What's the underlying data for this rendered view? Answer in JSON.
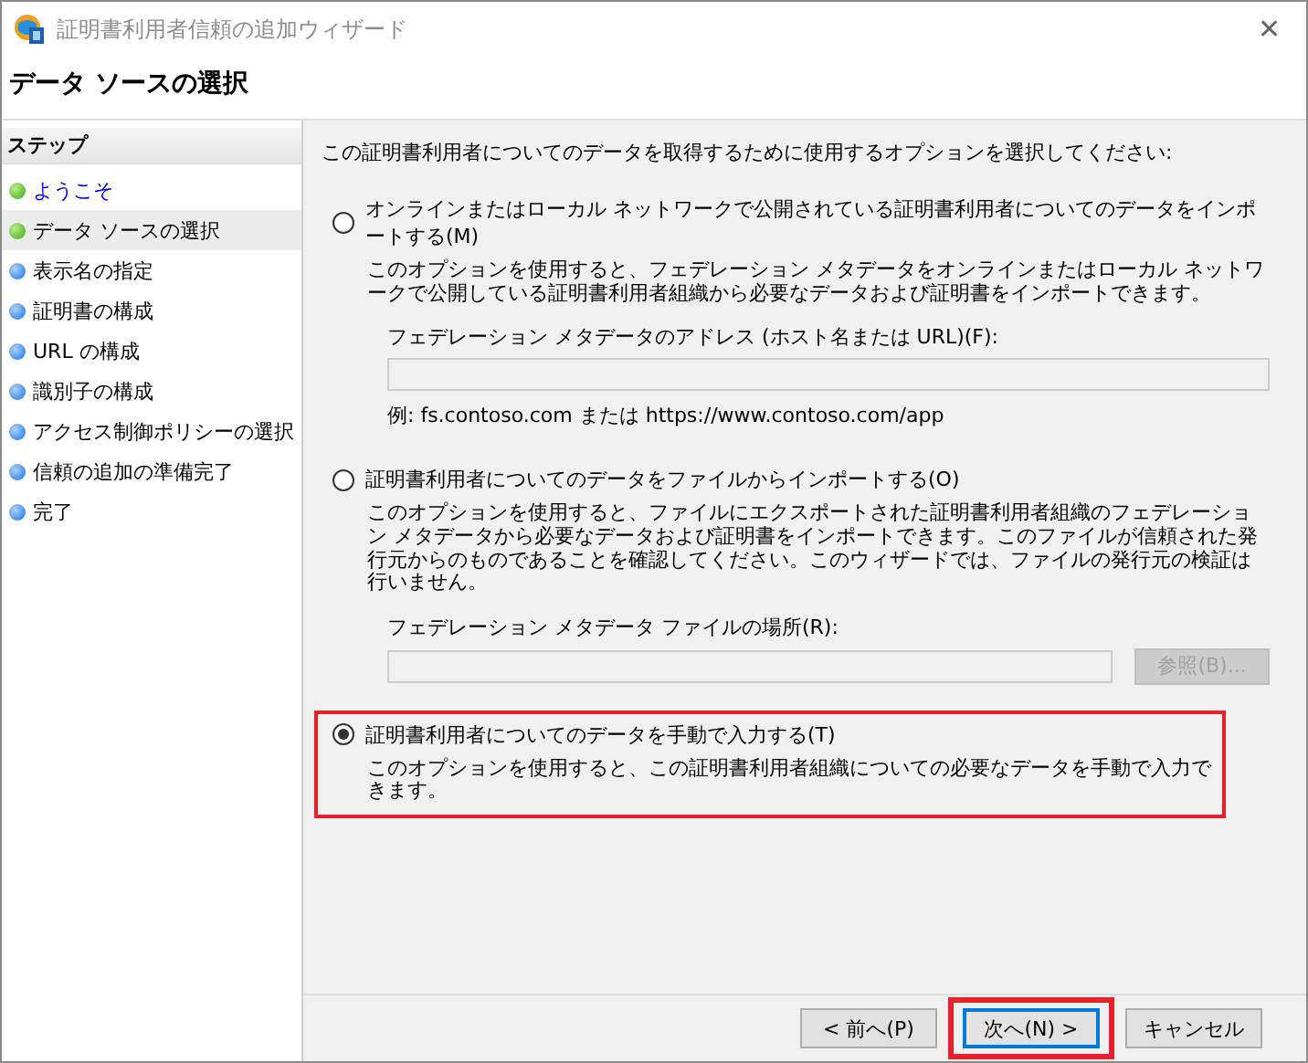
{
  "window": {
    "title": "証明書利用者信頼の追加ウィザード",
    "close": "✕"
  },
  "page_title": "データ ソースの選択",
  "steps": {
    "heading": "ステップ",
    "items": [
      {
        "label": "ようこそ",
        "completed": true,
        "link": true,
        "selected": false
      },
      {
        "label": "データ ソースの選択",
        "completed": true,
        "link": false,
        "selected": true
      },
      {
        "label": "表示名の指定",
        "completed": false,
        "link": false,
        "selected": false
      },
      {
        "label": "証明書の構成",
        "completed": false,
        "link": false,
        "selected": false
      },
      {
        "label": "URL の構成",
        "completed": false,
        "link": false,
        "selected": false
      },
      {
        "label": "識別子の構成",
        "completed": false,
        "link": false,
        "selected": false
      },
      {
        "label": "アクセス制御ポリシーの選択",
        "completed": false,
        "link": false,
        "selected": false
      },
      {
        "label": "信頼の追加の準備完了",
        "completed": false,
        "link": false,
        "selected": false
      },
      {
        "label": "完了",
        "completed": false,
        "link": false,
        "selected": false
      }
    ]
  },
  "intro": "この証明書利用者についてのデータを取得するために使用するオプションを選択してください:",
  "options": [
    {
      "label": "オンラインまたはローカル ネットワークで公開されている証明書利用者についてのデータをインポートする(M)",
      "selected": false,
      "highlighted": false,
      "description": "このオプションを使用すると、フェデレーション メタデータをオンラインまたはローカル ネットワークで公開している証明書利用者組織から必要なデータおよび証明書をインポートできます。",
      "field": {
        "label": "フェデレーション メタデータのアドレス (ホスト名または URL)(F):",
        "disabled": true,
        "hint": "例: fs.contoso.com または https://www.contoso.com/app"
      }
    },
    {
      "label": "証明書利用者についてのデータをファイルからインポートする(O)",
      "selected": false,
      "highlighted": false,
      "description": "このオプションを使用すると、ファイルにエクスポートされた証明書利用者組織のフェデレーション メタデータから必要なデータおよび証明書をインポートできます。このファイルが信頼された発行元からのものであることを確認してください。このウィザードでは、ファイルの発行元の検証は行いません。",
      "field": {
        "label": "フェデレーション メタデータ ファイルの場所(R):",
        "disabled": true,
        "button": "参照(B)..."
      }
    },
    {
      "label": "証明書利用者についてのデータを手動で入力する(T)",
      "selected": true,
      "highlighted": true,
      "description": "このオプションを使用すると、この証明書利用者組織についての必要なデータを手動で入力できます。"
    }
  ],
  "buttons": [
    {
      "label": "< 前へ(P)",
      "focused": false,
      "highlighted": false
    },
    {
      "label": "次へ(N) >",
      "focused": true,
      "highlighted": true
    },
    {
      "label": "キャンセル",
      "focused": false,
      "highlighted": false
    }
  ]
}
